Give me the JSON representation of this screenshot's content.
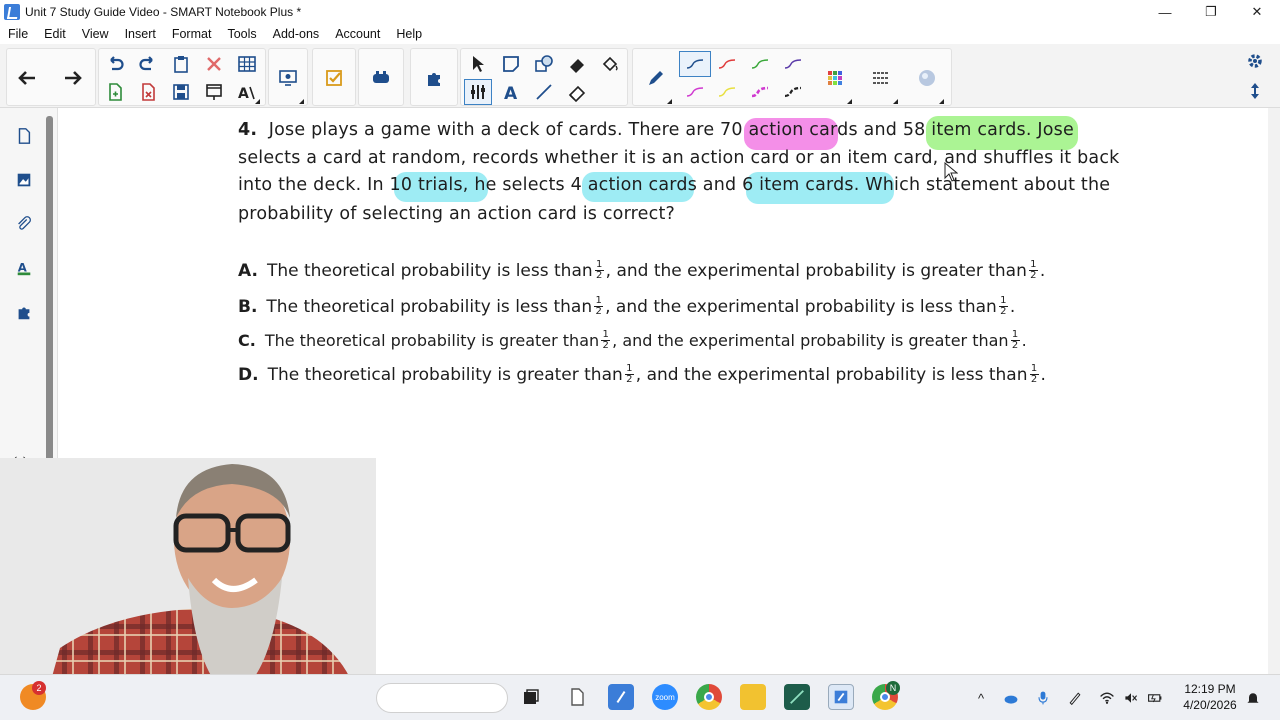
{
  "window": {
    "title": "Unit 7 Study Guide Video - SMART Notebook Plus *",
    "minimize": "—",
    "restore": "❐",
    "close": "✕"
  },
  "menu": [
    "File",
    "Edit",
    "View",
    "Insert",
    "Format",
    "Tools",
    "Add-ons",
    "Account",
    "Help"
  ],
  "question": {
    "number": "4.",
    "line1_a": "Jose plays a game with a deck of cards. There are ",
    "hl_action": "70 action",
    "line1_b": " cards and ",
    "hl_item": "58 item cards.",
    "line1_c": " Jose",
    "line2": "selects a card at random, records whether it is an action card or an item card, and shuffles it back",
    "line3_a": "into the deck. In ",
    "hl_trials": "10 trials,",
    "line3_b": " he selects ",
    "hl_action4": "4 action cards",
    "line3_c": " and ",
    "hl_item6": "6 item cards.",
    "line3_d": " Which statement about the",
    "line4": "probability of selecting an action card is correct?"
  },
  "choices": [
    {
      "letter": "A.",
      "part1": "The theoretical probability is less than ",
      "part2": ", and the experimental probability is greater than ",
      "end": "."
    },
    {
      "letter": "B.",
      "part1": "The theoretical probability is less than ",
      "part2": ", and the experimental probability is less than ",
      "end": "."
    },
    {
      "letter": "C.",
      "part1": "The theoretical probability is greater than ",
      "part2": ", and the experimental probability is greater than ",
      "end": "."
    },
    {
      "letter": "D.",
      "part1": "The theoretical probability is greater than ",
      "part2": ", and the experimental probability is less than ",
      "end": "."
    }
  ],
  "fraction": {
    "num": "1",
    "den": "2"
  },
  "highlight_colors": {
    "pink": "#f06ae0",
    "green": "#8ff070",
    "cyan": "#7ee6f0"
  },
  "taskbar": {
    "badge": "2",
    "time": "12:19 PM",
    "date": "4/20/2026",
    "chrome_badge": "N"
  }
}
